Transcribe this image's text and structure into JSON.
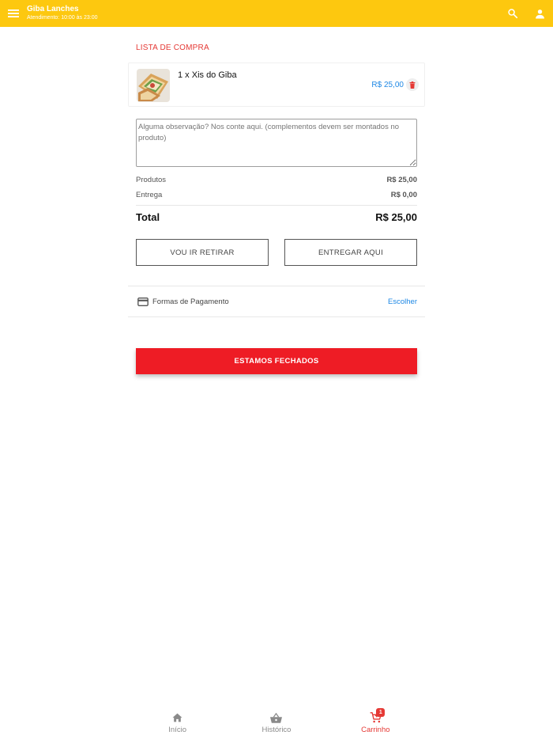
{
  "header": {
    "title": "Giba Lanches",
    "subtitle": "Atendimento: 10:00 às 23:00",
    "bg_color": "#fdc80f"
  },
  "cart": {
    "section_title": "LISTA DE COMPRA",
    "items": [
      {
        "label": "1 x Xis do Giba",
        "price": "R$ 25,00"
      }
    ],
    "notes_placeholder": "Alguma observação? Nos conte aqui. (complementos devem ser montados no produto)"
  },
  "summary": {
    "products_label": "Produtos",
    "products_value": "R$ 25,00",
    "delivery_label": "Entrega",
    "delivery_value": "R$ 0,00",
    "total_label": "Total",
    "total_value": "R$ 25,00"
  },
  "delivery_options": {
    "pickup_label": "VOU IR RETIRAR",
    "deliver_label": "ENTREGAR AQUI"
  },
  "payment": {
    "label": "Formas de Pagamento",
    "action": "Escolher"
  },
  "status_button": {
    "label": "ESTAMOS FECHADOS",
    "color": "#ee1c25"
  },
  "bottom_nav": {
    "items": [
      {
        "label": "Início",
        "icon": "home-icon"
      },
      {
        "label": "Histórico",
        "icon": "basket-icon"
      },
      {
        "label": "Carrinho",
        "icon": "cart-icon",
        "badge": "1",
        "active": true
      }
    ]
  },
  "icons": {
    "menu": "menu-icon",
    "search": "search-icon",
    "account": "account-icon",
    "trash": "trash-icon",
    "card": "credit-card-icon"
  },
  "colors": {
    "accent_red": "#e53935",
    "link_blue": "#1e88e5"
  }
}
